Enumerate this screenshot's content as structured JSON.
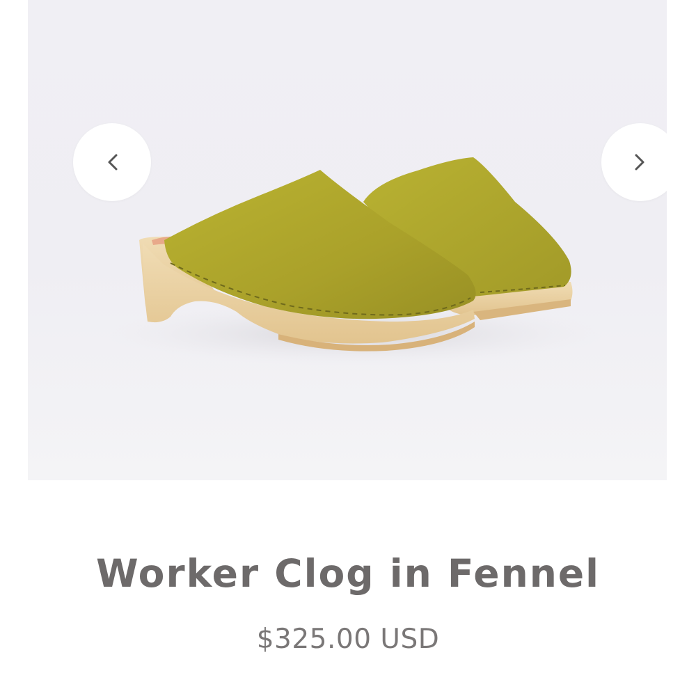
{
  "gallery": {
    "image_alt": "Worker Clog in Fennel",
    "prev_icon": "chevron-left-icon",
    "next_icon": "chevron-right-icon"
  },
  "product": {
    "title": "Worker Clog in Fennel",
    "price": "$325.00 USD"
  },
  "colors": {
    "suede": "#b0a82d",
    "wood": "#ead1a2",
    "text": "#6d6a6a"
  }
}
